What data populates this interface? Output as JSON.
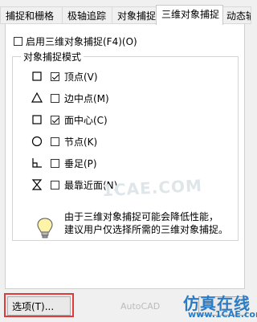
{
  "tabs": [
    {
      "label": "捕捉和栅格"
    },
    {
      "label": "极轴追踪"
    },
    {
      "label": "对象捕捉"
    },
    {
      "label": "三维对象捕捉"
    },
    {
      "label": "动态输入"
    }
  ],
  "enable": {
    "label": "启用三维对象捕捉(F4)(O)",
    "checked": false
  },
  "group": {
    "title": "对象捕捉模式",
    "modes": [
      {
        "symbol": "square-icon",
        "label": "顶点(V)",
        "checked": true
      },
      {
        "symbol": "triangle-icon",
        "label": "边中点(M)",
        "checked": false
      },
      {
        "symbol": "square-icon",
        "label": "面中心(C)",
        "checked": true
      },
      {
        "symbol": "circle-icon",
        "label": "节点(K)",
        "checked": false
      },
      {
        "symbol": "perpendicular-icon",
        "label": "垂足(P)",
        "checked": false
      },
      {
        "symbol": "hourglass-icon",
        "label": "最靠近面(N)",
        "checked": false
      }
    ]
  },
  "info": {
    "line1": "由于三维对象捕捉可能会降低性能，",
    "line2": "建议用户仅选择所需的三维对象捕捉。"
  },
  "buttons": {
    "options": "选项(T)..."
  },
  "watermarks": {
    "center": "1CAE.COM",
    "mid": "AutoCAD",
    "brand": "仿真在线",
    "url": "www.1CAE.com"
  },
  "colors": {
    "highlight": "#e03a3a",
    "brand": "#2b7bc3"
  }
}
